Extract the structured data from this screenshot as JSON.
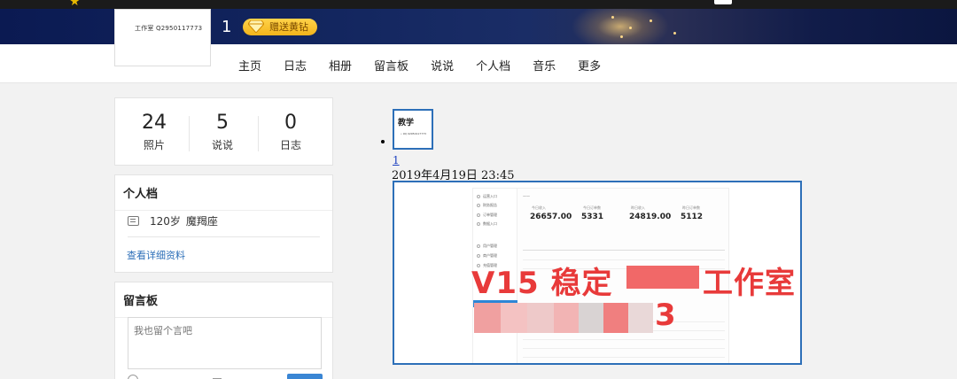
{
  "profile_header": {
    "avatar_text": "工作室 Q2950117773",
    "username": "1",
    "gift_button": "赠送黄钻"
  },
  "nav": {
    "items": [
      "主页",
      "日志",
      "相册",
      "留言板",
      "说说",
      "个人档",
      "音乐",
      "更多"
    ]
  },
  "stats": [
    {
      "value": "24",
      "label": "照片"
    },
    {
      "value": "5",
      "label": "说说"
    },
    {
      "value": "0",
      "label": "日志"
    }
  ],
  "profile_card": {
    "title": "个人档",
    "age": "120岁",
    "zodiac": "魔羯座",
    "details_link": "查看详细资料"
  },
  "guestbook": {
    "title": "留言板",
    "placeholder": "我也留个言吧"
  },
  "post": {
    "thumb_title": "教学",
    "thumb_subtitle": "• 9Q 02950117773",
    "link_text": "1",
    "timestamp": "2019年4月19日 23:45"
  },
  "screenshot": {
    "kpis": [
      {
        "label": "今日收入",
        "value": "26657.00"
      },
      {
        "label": "今日订单数",
        "value": "5331"
      },
      {
        "label": "昨日收入",
        "value": "24819.00"
      },
      {
        "label": "昨日订单数",
        "value": "5112"
      }
    ],
    "watermark_line1": "V15 稳定",
    "watermark_line1_end": "工作室",
    "watermark_line2_end": "3",
    "sidebar_items": [
      "运营入口",
      "财务报告",
      "订单管理",
      "数据入口",
      "",
      "用户管理",
      "商户管理",
      "充值管理",
      "",
      "",
      "",
      "订单列表"
    ]
  },
  "colors": {
    "accent": "#2d6fb8",
    "gift": "#f3b41b",
    "watermark": "#e83a3a"
  }
}
